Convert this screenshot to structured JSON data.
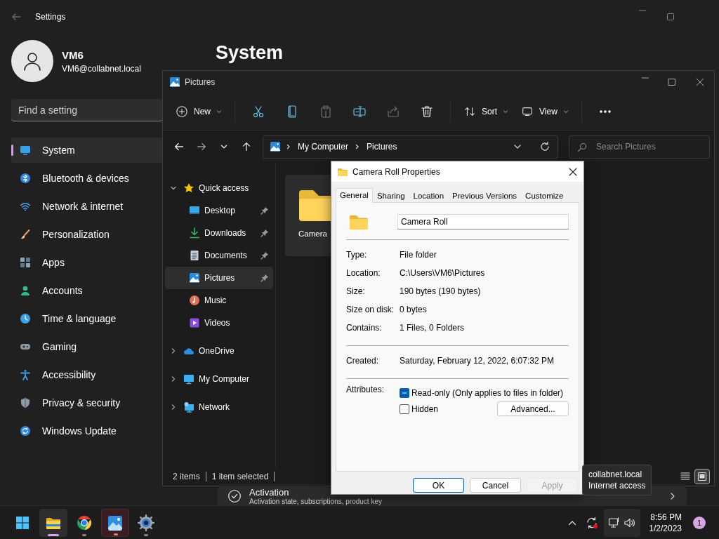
{
  "settings": {
    "title": "Settings",
    "user": {
      "name": "VM6",
      "email": "VM6@collabnet.local"
    },
    "search": {
      "placeholder": "Find a setting"
    },
    "nav": [
      {
        "label": "System",
        "selected": true
      },
      {
        "label": "Bluetooth & devices",
        "selected": false
      },
      {
        "label": "Network & internet",
        "selected": false
      },
      {
        "label": "Personalization",
        "selected": false
      },
      {
        "label": "Apps",
        "selected": false
      },
      {
        "label": "Accounts",
        "selected": false
      },
      {
        "label": "Time & language",
        "selected": false
      },
      {
        "label": "Gaming",
        "selected": false
      },
      {
        "label": "Accessibility",
        "selected": false
      },
      {
        "label": "Privacy & security",
        "selected": false
      },
      {
        "label": "Windows Update",
        "selected": false
      }
    ],
    "page_title": "System",
    "activation": {
      "title": "Activation",
      "subtitle": "Activation state, subscriptions, product key"
    }
  },
  "explorer": {
    "title": "Pictures",
    "toolbar": [
      {
        "kind": "menu",
        "label": "New",
        "disabled": false
      },
      {
        "kind": "separator"
      },
      {
        "kind": "icon",
        "disabled": false
      },
      {
        "kind": "icon",
        "disabled": false
      },
      {
        "kind": "icon",
        "disabled": true
      },
      {
        "kind": "icon",
        "disabled": false
      },
      {
        "kind": "icon",
        "disabled": true
      },
      {
        "kind": "icon",
        "disabled": false
      },
      {
        "kind": "separator"
      },
      {
        "kind": "menu",
        "label": "Sort",
        "disabled": false
      },
      {
        "kind": "menu",
        "label": "View",
        "disabled": false
      },
      {
        "kind": "separator"
      },
      {
        "kind": "icon",
        "disabled": false
      }
    ],
    "breadcrumb": [
      "My Computer",
      "Pictures"
    ],
    "search": {
      "placeholder": "Search Pictures"
    },
    "tree": [
      {
        "label": "Quick access",
        "expanded": true,
        "selected": false,
        "children": [
          {
            "label": "Desktop",
            "pinned": true,
            "selected": false
          },
          {
            "label": "Downloads",
            "pinned": true,
            "selected": false
          },
          {
            "label": "Documents",
            "pinned": true,
            "selected": false
          },
          {
            "label": "Pictures",
            "pinned": true,
            "selected": true
          },
          {
            "label": "Music",
            "pinned": false,
            "selected": false
          },
          {
            "label": "Videos",
            "pinned": false,
            "selected": false
          }
        ]
      },
      {
        "label": "OneDrive",
        "expanded": false,
        "selected": false
      },
      {
        "label": "My Computer",
        "expanded": false,
        "selected": false
      },
      {
        "label": "Network",
        "expanded": false,
        "selected": false
      }
    ],
    "items": [
      {
        "label": "Camera",
        "selected": true
      }
    ],
    "status": [
      "2 items",
      "1 item selected"
    ],
    "view_modes": [
      {
        "selected": false
      },
      {
        "selected": true
      }
    ]
  },
  "dialog": {
    "title": "Camera Roll Properties",
    "tabs": [
      {
        "label": "General",
        "selected": true
      },
      {
        "label": "Sharing",
        "selected": false
      },
      {
        "label": "Location",
        "selected": false
      },
      {
        "label": "Previous Versions",
        "selected": false
      },
      {
        "label": "Customize",
        "selected": false
      }
    ],
    "name": "Camera Roll",
    "sections": [
      [
        {
          "label": "Type:",
          "value": "File folder"
        },
        {
          "label": "Location:",
          "value": "C:\\Users\\VM6\\Pictures"
        },
        {
          "label": "Size:",
          "value": "190 bytes (190 bytes)"
        },
        {
          "label": "Size on disk:",
          "value": "0 bytes"
        },
        {
          "label": "Contains:",
          "value": "1 Files, 0 Folders"
        }
      ],
      [
        {
          "label": "Created:",
          "value": "Saturday, February 12, 2022, 6:07:32 PM"
        }
      ]
    ],
    "attributes": {
      "label": "Attributes:",
      "checkboxes": [
        {
          "label": "Read-only (Only applies to files in folder)",
          "checked": false,
          "indeterminate": true
        },
        {
          "label": "Hidden",
          "checked": false
        }
      ],
      "advanced": "Advanced..."
    },
    "buttons": [
      {
        "label": "OK",
        "default": true,
        "disabled": false
      },
      {
        "label": "Cancel",
        "default": false,
        "disabled": false
      },
      {
        "label": "Apply",
        "default": false,
        "disabled": true
      }
    ]
  },
  "tooltip": [
    "collabnet.local",
    "Internet access"
  ],
  "taskbar": {
    "apps": [
      {
        "running": true,
        "active": true,
        "hovered": false
      },
      {
        "running": true,
        "active": false,
        "hovered": false
      },
      {
        "running": true,
        "active": false,
        "hovered": true
      },
      {
        "running": true,
        "active": false,
        "hovered": false
      }
    ],
    "time": "8:56 PM",
    "date": "1/2/2023",
    "notifications": "1"
  }
}
